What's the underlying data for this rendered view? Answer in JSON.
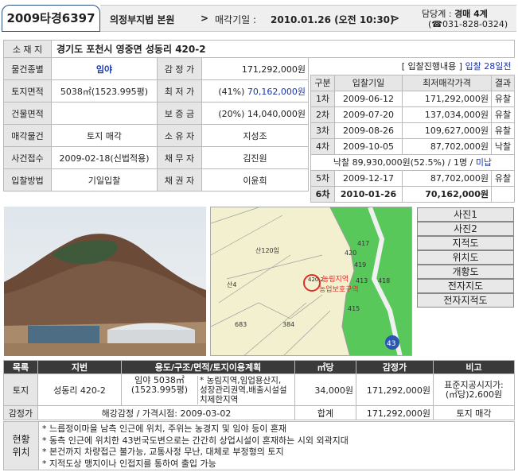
{
  "header": {
    "case_no": "2009타경6397",
    "court": "의정부지법 본원",
    "arrow": ">",
    "sale_label": "매각기일 :",
    "sale_date": "2010.01.26 (오전 10:30)",
    "dept_label": "담당계 :",
    "dept": "경매 4계",
    "tel": "(☎031-828-0324)"
  },
  "location": {
    "label": "소 재 지",
    "value": "경기도 포천시 영중면 성동리 420-2"
  },
  "info": {
    "rows": [
      {
        "l1": "물건종별",
        "v1": "임야",
        "l2": "감 정 가",
        "v2": "171,292,000원"
      },
      {
        "l1": "토지면적",
        "v1": "5038㎡(1523.995평)",
        "l2": "최 저 가",
        "v2a": "(41%)",
        "v2b": "70,162,000원"
      },
      {
        "l1": "건물면적",
        "v1": "",
        "l2": "보 증 금",
        "v2a": "(20%)",
        "v2b": "14,040,000원"
      },
      {
        "l1": "매각물건",
        "v1": "토지 매각",
        "l2": "소 유 자",
        "v2": "지성조"
      },
      {
        "l1": "사건접수",
        "v1": "2009-02-18(신법적용)",
        "l2": "채 무 자",
        "v2": "김진원"
      },
      {
        "l1": "입찰방법",
        "v1": "기일입찰",
        "l2": "채 권 자",
        "v2": "이윤희"
      }
    ]
  },
  "history": {
    "title_a": "[ 입찰진행내용 ]",
    "title_b": "입찰 28일전",
    "headers": [
      "구분",
      "입찰기일",
      "최저매각가격",
      "결과"
    ],
    "rows": [
      {
        "n": "1차",
        "date": "2009-06-12",
        "price": "171,292,000원",
        "result": "유찰"
      },
      {
        "n": "2차",
        "date": "2009-07-20",
        "price": "137,034,000원",
        "result": "유찰"
      },
      {
        "n": "3차",
        "date": "2009-08-26",
        "price": "109,627,000원",
        "result": "유찰"
      },
      {
        "n": "4차",
        "date": "2009-10-05",
        "price": "87,702,000원",
        "result": "낙찰"
      }
    ],
    "nakchal_a": "낙찰 89,930,000원(52.5%) / 1명 /",
    "nakchal_b": "미납",
    "row5": {
      "n": "5차",
      "date": "2009-12-17",
      "price": "87,702,000원",
      "result": "유찰"
    },
    "row6": {
      "n": "6차",
      "date": "2010-01-26",
      "price": "70,162,000원",
      "result": ""
    }
  },
  "map": {
    "labels": [
      "산120임",
      "420",
      "417",
      "419",
      "413",
      "415",
      "418",
      "산4",
      "683",
      "384",
      "43"
    ],
    "zone1": "농림지역",
    "zone2": "농업보호구역",
    "parcel": "420 2"
  },
  "side_buttons": [
    "사진1",
    "사진2",
    "지적도",
    "위치도",
    "개황도",
    "전자지도",
    "전자지적도"
  ],
  "bottom": {
    "headers": [
      "목록",
      "지번",
      "용도/구조/면적/토지이용계획",
      "㎡당",
      "감정가",
      "비고"
    ],
    "row": {
      "type": "토지",
      "lot": "성동리 420-2",
      "use1": "임야 5038㎡",
      "use2": "(1523.995평)",
      "plan1": "* 농림지역,임업용산지,",
      "plan2": "성장관리권역,배출시설설",
      "plan3": "치제한지역",
      "per_m2": "34,000원",
      "appraisal": "171,292,000원",
      "note1": "표준지공시지가:",
      "note2": "(㎡당)2,600원"
    },
    "summary": {
      "label": "감정가",
      "text": "해강감정 / 가격시점: 2009-03-02",
      "total_label": "합계",
      "total": "171,292,000원",
      "sale": "토지 매각"
    }
  },
  "location_desc": {
    "label1": "현황",
    "label2": "위치",
    "items": [
      "* 느릅정이마을 남측 인근에 위치, 주위는 농경지 및 임야 등이 혼재",
      "* 동측 인근에 위치한 43번국도변으로는 간간히 상업시설이 혼재하는 시외 외곽지대",
      "* 본건까지 차량접근 불가능, 교통사정 무난, 대체로 부정형의 토지",
      "* 지적도상 맹지이나 인접지를 통하여 출입 가능"
    ]
  }
}
